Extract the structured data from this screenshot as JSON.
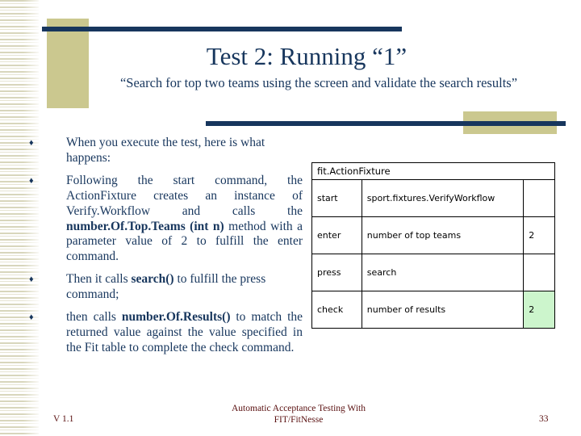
{
  "slide": {
    "title": "Test 2: Running “1”",
    "subtitle": "“Search for top two teams using the screen and validate the search results”",
    "colors": {
      "navy": "#17365d",
      "khaki": "#cbc88f",
      "stripe": "#d8d6bc",
      "footer_maroon": "#5a1111",
      "pass_green": "#ccf5cc",
      "background": "#ffffff"
    }
  },
  "bullets": [
    {
      "marker": "♦",
      "segments": [
        {
          "text": "When you execute the test, here is what happens:",
          "bold": false
        }
      ]
    },
    {
      "marker": "♦",
      "segments": [
        {
          "text": "Following the start command, the ActionFixture creates an instance of Verify.Workflow and calls the ",
          "bold": false
        },
        {
          "text": "number.Of.Top.Teams    (int    n)",
          "bold": true
        },
        {
          "text": " method with a parameter value of 2 to fulfill the enter command.",
          "bold": false
        }
      ]
    },
    {
      "marker": "♦",
      "segments": [
        {
          "text": "Then it calls ",
          "bold": false
        },
        {
          "text": "search()",
          "bold": true
        },
        {
          "text": " to fulfill the press command;",
          "bold": false
        }
      ]
    },
    {
      "marker": "♦",
      "segments": [
        {
          "text": "then calls ",
          "bold": false
        },
        {
          "text": "number.Of.Results()",
          "bold": true
        },
        {
          "text": " to match the returned value against the value specified in the Fit table to complete the check command.",
          "bold": false
        }
      ]
    }
  ],
  "fit_table": {
    "fixture_name": "fit.ActionFixture",
    "rows": [
      {
        "command": "start",
        "argument": "sport.fixtures.VerifyWorkflow",
        "value": "",
        "status": "none"
      },
      {
        "command": "enter",
        "argument": "number of top teams",
        "value": "2",
        "status": "none"
      },
      {
        "command": "press",
        "argument": "search",
        "value": "",
        "status": "none"
      },
      {
        "command": "check",
        "argument": "number of results",
        "value": "2",
        "status": "pass"
      }
    ]
  },
  "footer": {
    "version": "V 1.1",
    "line1": "Automatic Acceptance Testing With",
    "line2": "FIT/FitNesse",
    "page_number": "33"
  }
}
